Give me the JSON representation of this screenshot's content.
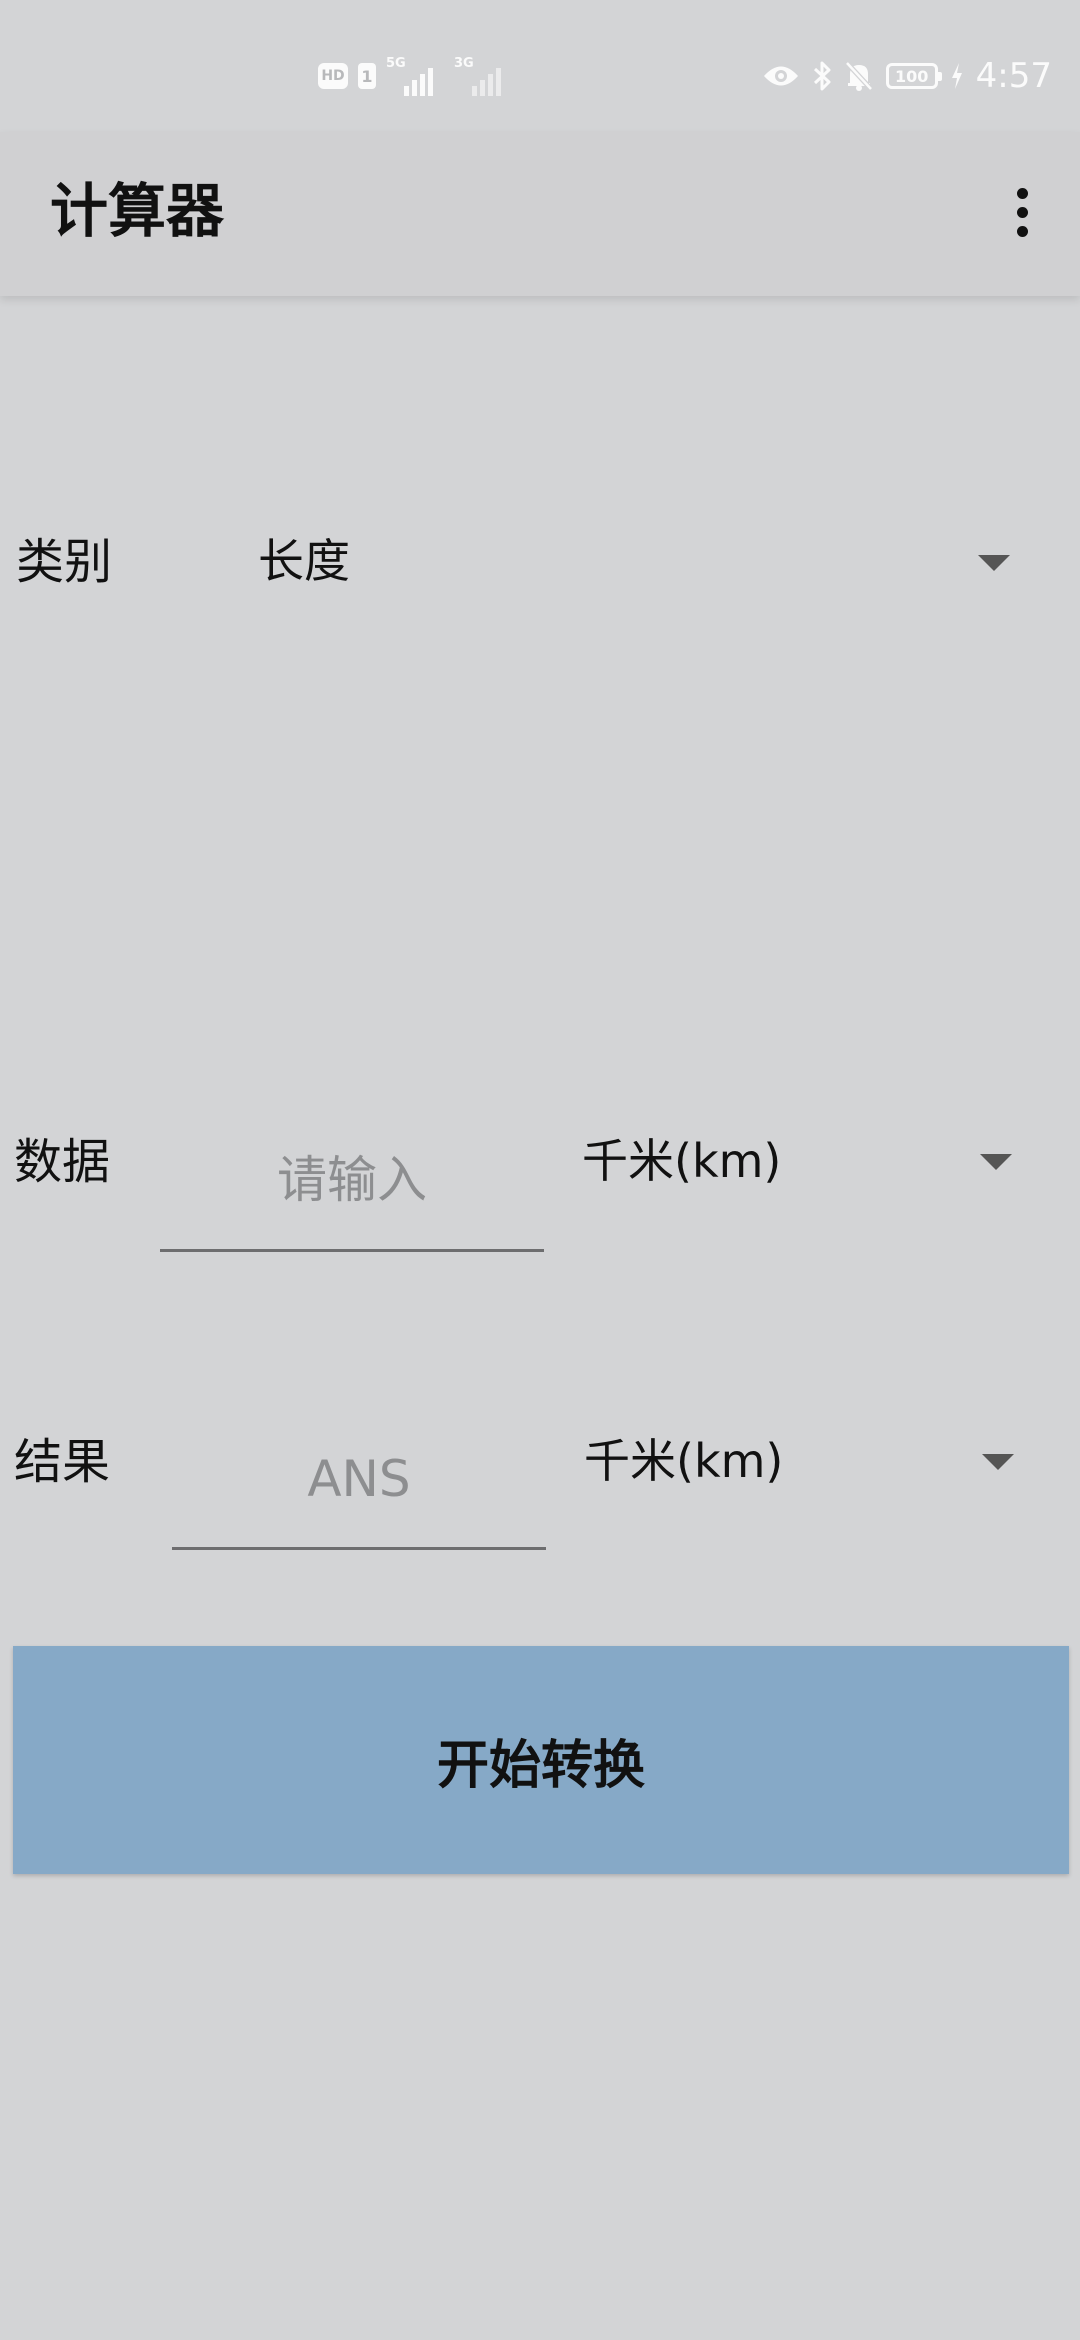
{
  "status_bar": {
    "hd_label": "HD",
    "sim_label": "1",
    "network_1": "5G",
    "network_2": "3G",
    "battery_level": "100",
    "time": "4:57",
    "icons": [
      "eye-icon",
      "bluetooth-icon",
      "bell-off-icon",
      "battery-icon",
      "charging-icon"
    ]
  },
  "app_bar": {
    "title": "计算器",
    "menu_icon": "more-vert-icon"
  },
  "form": {
    "category": {
      "label": "类别",
      "selected": "长度"
    },
    "data": {
      "label": "数据",
      "placeholder": "请输入",
      "value": "",
      "unit": "千米(km)"
    },
    "result": {
      "label": "结果",
      "placeholder": "ANS",
      "value": "",
      "unit": "千米(km)"
    },
    "convert_button": "开始转换"
  },
  "colors": {
    "background": "#d3d4d6",
    "app_bar": "#d0d0d2",
    "button": "#86a9c7",
    "underline": "#6d6d6f",
    "caret": "#555555"
  }
}
